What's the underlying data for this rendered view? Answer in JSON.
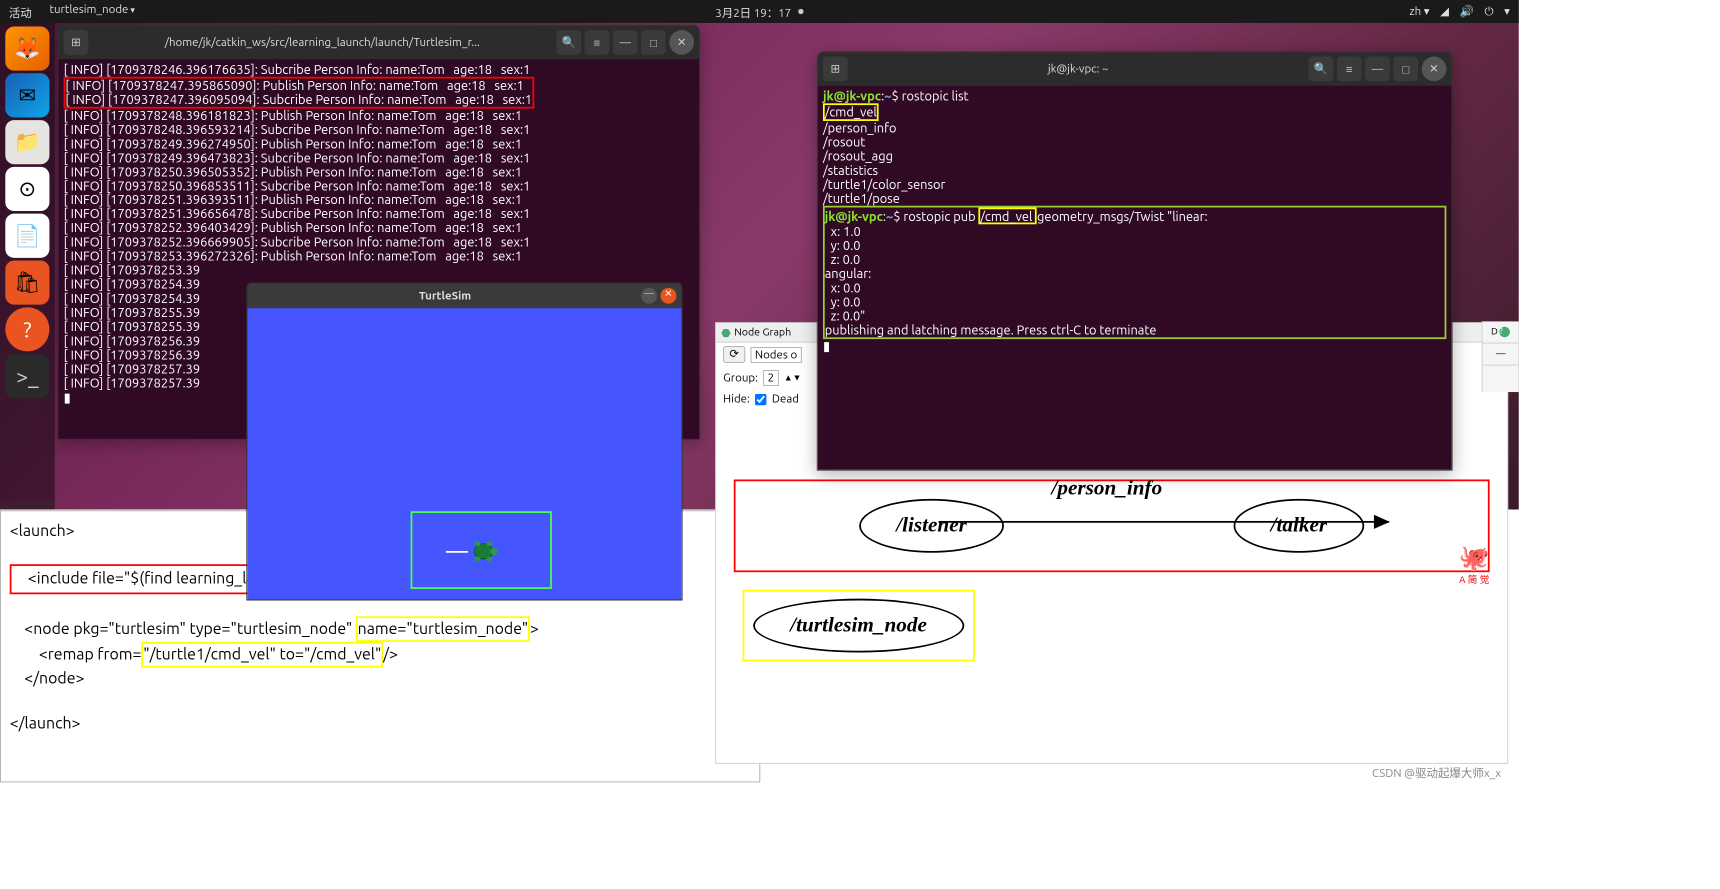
{
  "topbar": {
    "activities": "活动",
    "app": "turtlesim_node",
    "date": "3月2日 19：17",
    "lang": "zh ▾"
  },
  "dock": {
    "items": [
      "firefox",
      "thunderbird",
      "files",
      "rhythmbox",
      "writer",
      "software",
      "help",
      "terminal"
    ]
  },
  "win1": {
    "title": "/home/jk/catkin_ws/src/learning_launch/launch/Turtlesim_r...",
    "lines": [
      "[ INFO] [1709378246.396176635]: Subcribe Person Info: name:Tom   age:18   sex:1",
      "[ INFO] [1709378247.395865090]: Publish Person Info: name:Tom   age:18   sex:1",
      "[ INFO] [1709378247.396095094]: Subcribe Person Info: name:Tom   age:18   sex:1",
      "[ INFO] [1709378248.396181823]: Publish Person Info: name:Tom   age:18   sex:1",
      "[ INFO] [1709378248.396593214]: Subcribe Person Info: name:Tom   age:18   sex:1",
      "[ INFO] [1709378249.396274950]: Publish Person Info: name:Tom   age:18   sex:1",
      "[ INFO] [1709378249.396473823]: Subcribe Person Info: name:Tom   age:18   sex:1",
      "[ INFO] [1709378250.396505352]: Publish Person Info: name:Tom   age:18   sex:1",
      "[ INFO] [1709378250.396853511]: Subcribe Person Info: name:Tom   age:18   sex:1",
      "[ INFO] [1709378251.396393511]: Publish Person Info: name:Tom   age:18   sex:1",
      "[ INFO] [1709378251.396656478]: Subcribe Person Info: name:Tom   age:18   sex:1",
      "[ INFO] [1709378252.396403429]: Publish Person Info: name:Tom   age:18   sex:1",
      "[ INFO] [1709378252.396669905]: Subcribe Person Info: name:Tom   age:18   sex:1",
      "[ INFO] [1709378253.396272326]: Publish Person Info: name:Tom   age:18   sex:1",
      "[ INFO] [1709378253.39",
      "[ INFO] [1709378254.39",
      "[ INFO] [1709378254.39",
      "[ INFO] [1709378255.39",
      "[ INFO] [1709378255.39",
      "[ INFO] [1709378256.39",
      "[ INFO] [1709378256.39",
      "[ INFO] [1709378257.39",
      "[ INFO] [1709378257.39"
    ]
  },
  "turtlesim": {
    "title": "TurtleSim"
  },
  "win2": {
    "title": "jk@jk-vpc: ~",
    "prompt1": "jk@jk-vpc:~$ ",
    "cmd1": "rostopic list",
    "topics": [
      "/cmd_vel",
      "/person_info",
      "/rosout",
      "/rosout_agg",
      "/statistics",
      "/turtle1/color_sensor",
      "/turtle1/pose"
    ],
    "cmd2a": "rostopic pub ",
    "cmd2b": "/cmd_vel ",
    "cmd2c": "geometry_msgs/Twist \"linear:",
    "body": [
      "  x: 1.0",
      "  y: 0.0",
      "  z: 0.0",
      "angular:",
      "  x: 0.0",
      "  y: 0.0",
      "  z: 0.0\""
    ],
    "latch": "publishing and latching message. Press ctrl-C to terminate"
  },
  "nodegraph": {
    "tab": "Node Graph",
    "refresh": "⟳",
    "nodesOnly": "Nodes o",
    "groupLabel": "Group:",
    "groupVal": "2",
    "hideLabel": "Hide:",
    "deadLabel": "Dead",
    "listener": "/listener",
    "edge": "/person_info",
    "talker": "/talker",
    "turtle": "/turtlesim_node",
    "mascot": "A 简 觉",
    "dbtn": "D"
  },
  "xml": {
    "l1": "<launch>",
    "l2": "    <include file=\"$(find learning_launch)/launch/simple.launch\" />",
    "l3a": "    <node pkg=\"turtlesim\" type=\"turtlesim_node\" ",
    "l3b": "name=\"turtlesim_node\"",
    "l3c": ">",
    "l4a": "        <remap from=",
    "l4b": "\"/turtle1/cmd_vel\" to=\"/cmd_vel\"",
    "l4c": "/>",
    "l5": "    </node>",
    "l6": "</launch>"
  },
  "watermark": "CSDN @驱动起爆大师x_x"
}
